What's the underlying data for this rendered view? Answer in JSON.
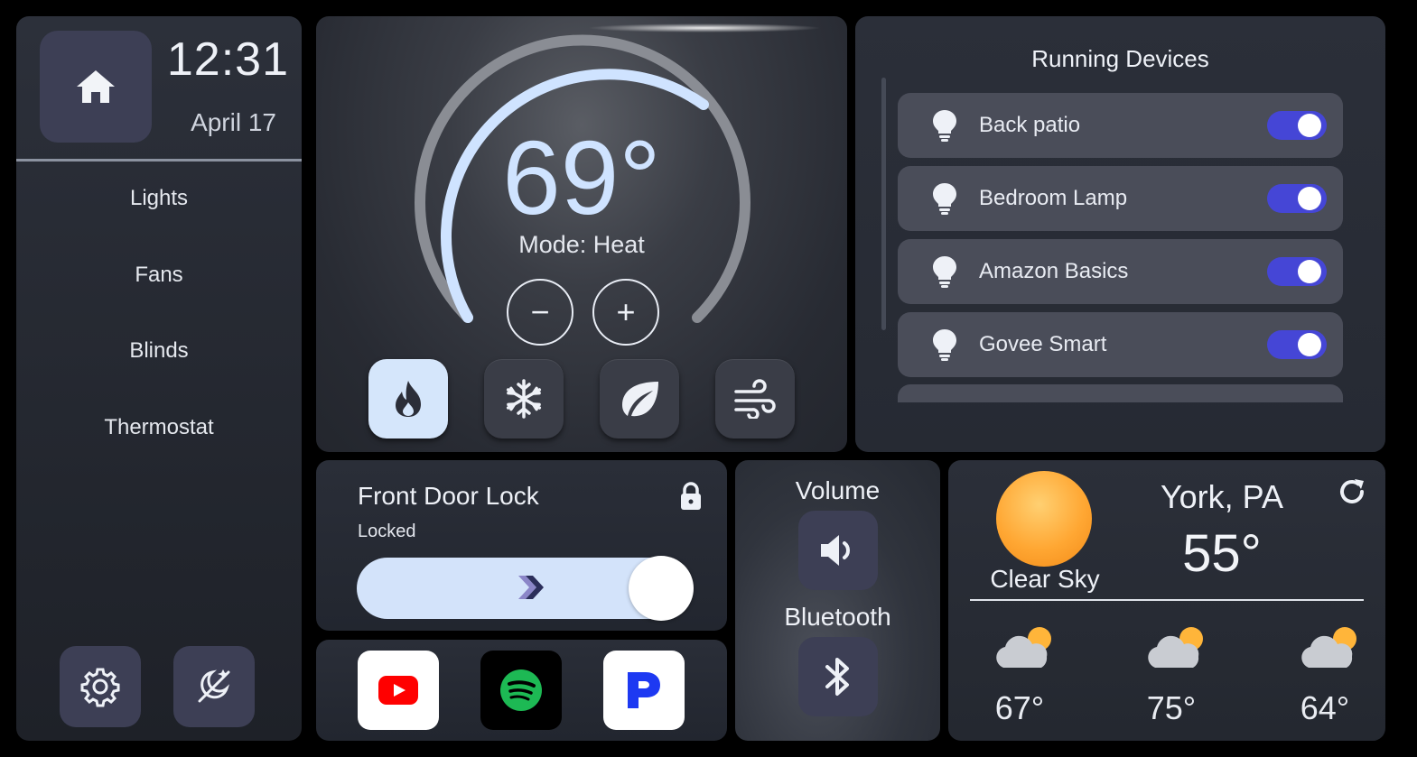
{
  "clock": {
    "time": "12:31",
    "date": "April 17"
  },
  "nav": [
    "Lights",
    "Fans",
    "Blinds",
    "Thermostat"
  ],
  "icons": {
    "home": "home-icon",
    "settings": "gear-icon",
    "theme": "night-mode-icon",
    "heat": "flame-icon",
    "cool": "snowflake-icon",
    "eco": "leaf-icon",
    "fan": "wind-icon",
    "bulb": "lightbulb-icon",
    "lock": "lock-icon",
    "volume": "speaker-icon",
    "bluetooth": "bluetooth-icon",
    "refresh": "refresh-icon"
  },
  "thermostat": {
    "temperature": "69°",
    "mode": "Mode: Heat",
    "decrease": "−",
    "increase": "+",
    "modes": [
      "heat",
      "cool",
      "eco",
      "fan"
    ],
    "active_mode": "heat",
    "accent": "#d5e6fb"
  },
  "devices": {
    "title": "Running Devices",
    "items": [
      {
        "label": "Back patio",
        "on": true
      },
      {
        "label": "Bedroom Lamp",
        "on": true
      },
      {
        "label": "Amazon Basics",
        "on": true
      },
      {
        "label": "Govee Smart",
        "on": true
      }
    ],
    "toggle_color": "#4546d6"
  },
  "lock": {
    "title": "Front Door Lock",
    "status": "Locked"
  },
  "apps": [
    "youtube",
    "spotify",
    "pandora"
  ],
  "media": {
    "volume_label": "Volume",
    "bluetooth_label": "Bluetooth"
  },
  "weather": {
    "city": "York, PA",
    "temperature": "55°",
    "condition": "Clear Sky",
    "forecast": [
      {
        "temp": "67°",
        "icon": "partly-cloudy-icon"
      },
      {
        "temp": "75°",
        "icon": "partly-cloudy-icon"
      },
      {
        "temp": "64°",
        "icon": "partly-cloudy-icon"
      }
    ]
  }
}
